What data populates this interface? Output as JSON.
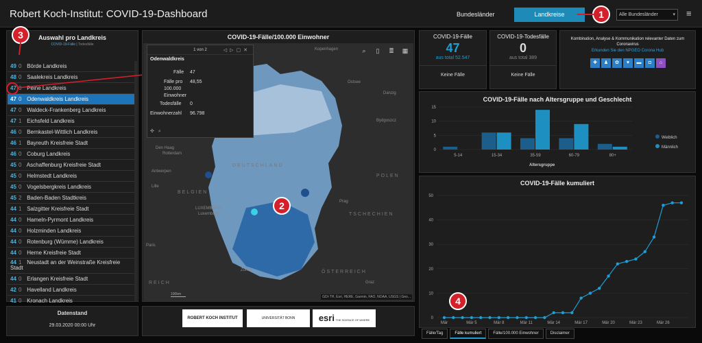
{
  "header": {
    "title": "Robert Koch-Institut: COVID-19-Dashboard",
    "link_bundeslaender": "Bundesländer",
    "btn_landkreise": "Landkreise",
    "select_value": "Alle Bundesländer",
    "menu_icon": "hamburger-icon"
  },
  "callouts": [
    "1",
    "2",
    "3",
    "4"
  ],
  "list": {
    "title": "Auswahl pro Landkreis",
    "subtitle_a": "COVID-19-Fälle",
    "subtitle_b": "Todesfälle",
    "rows": [
      {
        "cases": "49",
        "deaths": "0",
        "name": "Börde Landkreis"
      },
      {
        "cases": "48",
        "deaths": "0",
        "name": "Saalekreis Landkreis"
      },
      {
        "cases": "47",
        "deaths": "0",
        "name": "Peine Landkreis"
      },
      {
        "cases": "47",
        "deaths": "0",
        "name": "Odenwaldkreis Landkreis"
      },
      {
        "cases": "47",
        "deaths": "0",
        "name": "Waldeck-Frankenberg Landkreis"
      },
      {
        "cases": "47",
        "deaths": "1",
        "name": "Eichsfeld Landkreis"
      },
      {
        "cases": "46",
        "deaths": "0",
        "name": "Bernkastel-Wittlich Landkreis"
      },
      {
        "cases": "46",
        "deaths": "1",
        "name": "Bayreuth Kreisfreie Stadt"
      },
      {
        "cases": "46",
        "deaths": "0",
        "name": "Coburg Landkreis"
      },
      {
        "cases": "45",
        "deaths": "0",
        "name": "Aschaffenburg Kreisfreie Stadt"
      },
      {
        "cases": "45",
        "deaths": "0",
        "name": "Helmstedt Landkreis"
      },
      {
        "cases": "45",
        "deaths": "0",
        "name": "Vogelsbergkreis Landkreis"
      },
      {
        "cases": "45",
        "deaths": "2",
        "name": "Baden-Baden Stadtkreis"
      },
      {
        "cases": "44",
        "deaths": "1",
        "name": "Salzgitter Kreisfreie Stadt"
      },
      {
        "cases": "44",
        "deaths": "0",
        "name": "Hameln-Pyrmont Landkreis"
      },
      {
        "cases": "44",
        "deaths": "0",
        "name": "Holzminden Landkreis"
      },
      {
        "cases": "44",
        "deaths": "0",
        "name": "Rotenburg (Wümme) Landkreis"
      },
      {
        "cases": "44",
        "deaths": "0",
        "name": "Herne Kreisfreie Stadt"
      },
      {
        "cases": "44",
        "deaths": "1",
        "name": "Neustadt an der Weinstraße Kreisfreie Stadt"
      },
      {
        "cases": "44",
        "deaths": "0",
        "name": "Erlangen Kreisfreie Stadt"
      },
      {
        "cases": "42",
        "deaths": "0",
        "name": "Havelland Landkreis"
      },
      {
        "cases": "41",
        "deaths": "0",
        "name": "Kronach Landkreis"
      }
    ],
    "selected_index": 3
  },
  "date": {
    "label": "Datenstand",
    "value": "29.03.2020 00:00 Uhr"
  },
  "map": {
    "title": "COVID-19-Fälle/100.000 Einwohner",
    "popup": {
      "pager": "1 von 2",
      "name": "Odenwaldkreis",
      "rows": [
        {
          "label": "Fälle",
          "value": "47"
        },
        {
          "label": "Fälle pro",
          "value": "48,55"
        },
        {
          "label": "100.000",
          "value": ""
        },
        {
          "label": "Einwohner",
          "value": ""
        },
        {
          "label": "Todesfälle",
          "value": "0"
        },
        {
          "label": "Einwohnerzahl",
          "value": "96.798"
        }
      ]
    },
    "labels": {
      "kopenhagen": "Kopenhagen",
      "ostsee": "Ostsee",
      "danzig": "Danzig",
      "bydgoszcz": "Bydgoszcz",
      "den_haag": "Den Haag",
      "rotterdam": "Rotterdam",
      "deutschland": "DEUTSCHLAND",
      "polen": "POLEN",
      "antwerpen": "Antwerpen",
      "belgien": "BELGIEN",
      "lille": "Lille",
      "luxemburg": "LUXEMBURG",
      "luxemburg_city": "Luxemburg",
      "prag": "Prag",
      "tschechien": "TSCHECHIEN",
      "zuerich": "Zürich",
      "oesterreich": "ÖSTERREICH",
      "graz": "Graz",
      "frankreich": "REICH",
      "paris": "Paris"
    },
    "scale": "100km",
    "attribution": "GDI-TH, Esri, HERE, Garmin, FAO, NOAA, USGS | Geo..."
  },
  "logos": {
    "rki": "ROBERT KOCH INSTITUT",
    "uni": "UNIVERSITÄT BONN",
    "esri": "esri",
    "esri_tag": "THE SCIENCE OF WHERE"
  },
  "stats": {
    "cases": {
      "title": "COVID-19-Fälle",
      "value": "47",
      "sub": "aus total 52.547",
      "foot": "Keine Fälle"
    },
    "deaths": {
      "title": "COVID-19-Todesfälle",
      "value": "0",
      "sub": "aus total 389",
      "foot": "Keine Fälle"
    },
    "info": {
      "text": "Kombination, Analyse & Kommunikation relevanter Daten zum Coronavirus",
      "link": "Erkunden Sie den NPGEO Corona Hub"
    }
  },
  "age_chart": {
    "title": "COVID-19-Fälle nach Altersgruppe und Geschlecht",
    "xlabel": "Altersgruppe",
    "legend": [
      "Weiblich",
      "Männlich"
    ]
  },
  "cum_chart": {
    "title": "COVID-19-Fälle kumuliert"
  },
  "tabs": [
    "Fälle/Tag",
    "Fälle kumuliert",
    "Fälle/100.000 Einwohner",
    "Disclaimer"
  ],
  "active_tab": 1,
  "colors": {
    "accent": "#1d9fd6",
    "selected": "#1d74b8",
    "female": "#1b5e8c",
    "male": "#1d8fc0",
    "callout": "#d4202a"
  },
  "chart_data": [
    {
      "type": "bar",
      "title": "COVID-19-Fälle nach Altersgruppe und Geschlecht",
      "xlabel": "Altersgruppe",
      "ylabel": "",
      "categories": [
        "5-14",
        "15-34",
        "35-59",
        "60-79",
        "80+"
      ],
      "series": [
        {
          "name": "Weiblich",
          "values": [
            1,
            6,
            4,
            4,
            2
          ]
        },
        {
          "name": "Männlich",
          "values": [
            0,
            6,
            14,
            9,
            1
          ]
        }
      ],
      "ylim": [
        0,
        15
      ],
      "yticks": [
        0,
        5,
        10,
        15
      ],
      "legend": "right"
    },
    {
      "type": "line",
      "title": "COVID-19-Fälle kumuliert",
      "x": [
        "Mär 2",
        "Mär 3",
        "Mär 4",
        "Mär 5",
        "Mär 6",
        "Mär 7",
        "Mär 8",
        "Mär 9",
        "Mär 10",
        "Mär 11",
        "Mär 12",
        "Mär 13",
        "Mär 14",
        "Mär 15",
        "Mär 16",
        "Mär 17",
        "Mär 18",
        "Mär 19",
        "Mär 20",
        "Mär 21",
        "Mär 22",
        "Mär 23",
        "Mär 24",
        "Mär 25",
        "Mär 26",
        "Mär 27",
        "Mär 28"
      ],
      "xticks": [
        "Mär",
        "Mär 5",
        "Mär 8",
        "Mär 11",
        "Mär 14",
        "Mär 17",
        "Mär 20",
        "Mär 23",
        "Mär 26"
      ],
      "values": [
        0,
        0,
        0,
        0,
        0,
        0,
        0,
        0,
        0,
        0,
        0,
        0,
        2,
        2,
        2,
        8,
        10,
        12,
        17,
        22,
        23,
        24,
        27,
        33,
        46,
        47,
        47
      ],
      "ylim": [
        0,
        50
      ],
      "yticks": [
        0,
        10,
        20,
        30,
        40,
        50
      ]
    }
  ]
}
